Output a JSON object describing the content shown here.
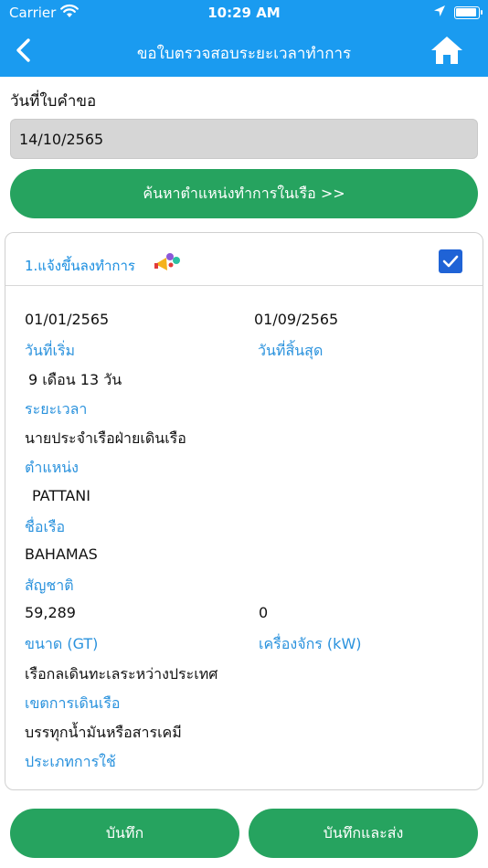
{
  "status_bar": {
    "carrier": "Carrier",
    "time": "10:29 AM"
  },
  "nav": {
    "title": "ขอใบตรวจสอบระยะเวลาทำการ"
  },
  "form": {
    "date_label": "วันที่ใบคำขอ",
    "date_value": "14/10/2565",
    "search_button": "ค้นหาตำแหน่งทำการในเรือ >>"
  },
  "card": {
    "title": "1.แจ้งขึ้นลงทำการ",
    "checked": true,
    "start_date": "01/01/2565",
    "start_label": "วันที่เริ่ม",
    "end_date": "01/09/2565",
    "end_label": "วันที่สิ้นสุด",
    "duration": "9 เดือน 13 วัน",
    "duration_label": "ระยะเวลา",
    "position": "นายประจำเรือฝ่ายเดินเรือ",
    "position_label": "ตำแหน่ง",
    "ship_name": "PATTANI",
    "ship_name_label": "ชื่อเรือ",
    "nationality": "BAHAMAS",
    "nationality_label": "สัญชาติ",
    "size": "59,289",
    "size_label": "ขนาด (GT)",
    "engine": "0",
    "engine_label": "เครื่องจักร (kW)",
    "area": "เรือกลเดินทะเลระหว่างประเทศ",
    "area_label": "เขตการเดินเรือ",
    "usage": "บรรทุกน้ำมันหรือสารเคมี",
    "usage_label": "ประเภทการใช้"
  },
  "footer": {
    "save_button": "บันทึก",
    "save_send_button": "บันทึกและส่ง"
  },
  "colors": {
    "primary": "#1a9bf0",
    "button": "#26a35f",
    "label": "#2a92dd",
    "checkbox": "#1f63d6"
  }
}
